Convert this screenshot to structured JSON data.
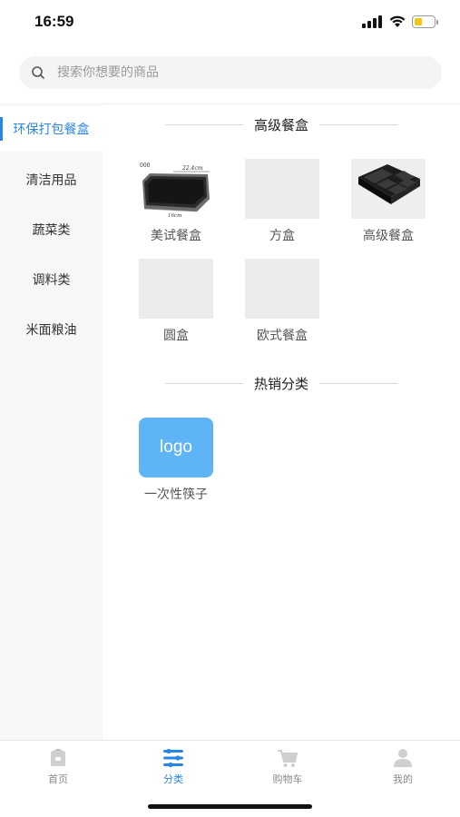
{
  "status_bar": {
    "time": "16:59",
    "battery_color": "#f5c518"
  },
  "search": {
    "placeholder": "搜索你想要的商品"
  },
  "sidebar": {
    "items": [
      {
        "label": "环保打包餐盒",
        "active": true
      },
      {
        "label": "清洁用品",
        "active": false
      },
      {
        "label": "蔬菜类",
        "active": false
      },
      {
        "label": "调料类",
        "active": false
      },
      {
        "label": "米面粮油",
        "active": false
      }
    ]
  },
  "sections": [
    {
      "title": "高级餐盒",
      "products": [
        {
          "name": "美试餐盒",
          "image": "black-container-photo"
        },
        {
          "name": "方盒",
          "image": "placeholder"
        },
        {
          "name": "高级餐盒",
          "image": "compartment-tray-photo"
        },
        {
          "name": "圆盒",
          "image": "placeholder"
        },
        {
          "name": "欧式餐盒",
          "image": "placeholder"
        }
      ]
    },
    {
      "title": "热销分类",
      "products": [
        {
          "name": "一次性筷子",
          "image": "logo-placeholder",
          "logo_text": "logo"
        }
      ]
    }
  ],
  "photo_labels": {
    "dim_top": "22.4cm",
    "dim_side": "16cm",
    "dim_left": "000"
  },
  "tab_bar": {
    "tabs": [
      {
        "label": "首页",
        "icon": "home-icon",
        "active": false
      },
      {
        "label": "分类",
        "icon": "category-icon",
        "active": true
      },
      {
        "label": "购物车",
        "icon": "cart-icon",
        "active": false
      },
      {
        "label": "我的",
        "icon": "profile-icon",
        "active": false
      }
    ]
  },
  "colors": {
    "accent": "#2a86e6",
    "logo_bg": "#5fb4f5",
    "sidebar_bg": "#f7f7f7"
  }
}
